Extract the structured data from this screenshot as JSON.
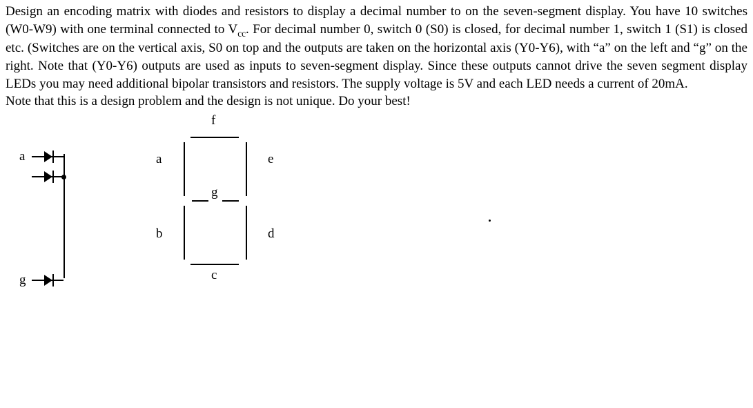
{
  "problem": {
    "line1": "Design an encoding matrix with diodes and resistors to display a decimal number to on the seven-segment display. You have 10 switches (W0-W9) with one terminal connected to V",
    "sub1": "cc",
    "line1b": ". For decimal number 0, switch 0 (S0) is closed, for decimal number 1, switch 1 (S1) is closed etc. (Switches are on the vertical axis, S0 on top and the outputs are taken on the horizontal axis (Y0-Y6), with “a” on the left and “g” on the right. Note that (Y0-Y6) outputs are used as inputs to seven-segment display. Since these outputs cannot drive the seven segment display LEDs you may need additional bipolar transistors and resistors. The supply voltage is 5V and each LED needs a current of 20mA.",
    "note": "Note that this is a design problem and the design is not unique. Do your best!"
  },
  "diode_fig": {
    "label_a": "a",
    "label_g": "g"
  },
  "seven_seg": {
    "a": "a",
    "b": "b",
    "c": "c",
    "d": "d",
    "e": "e",
    "f": "f",
    "g": "g"
  }
}
